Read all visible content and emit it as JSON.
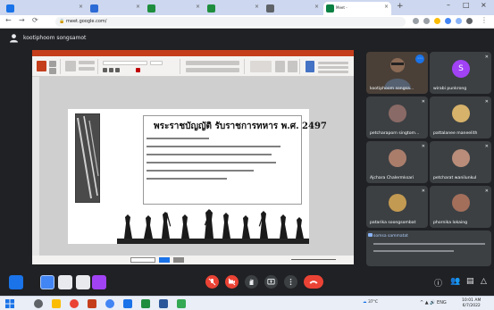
{
  "browser": {
    "tabs": [
      {
        "label": "",
        "color": "#1a73e8"
      },
      {
        "label": "",
        "color": "#2c6ad6"
      },
      {
        "label": "",
        "color": "#1e8e3e"
      },
      {
        "label": "",
        "color": "#1e8e3e"
      },
      {
        "label": "",
        "color": "#5f6368"
      },
      {
        "label": "Meet - ",
        "color": "#0b8043"
      }
    ],
    "url": "meet.google.com/"
  },
  "meet": {
    "presenter": "kootiphoom songsamot",
    "accent": "#1a73e8",
    "end_call_color": "#ea4335"
  },
  "slide": {
    "title": "พระราชบัญญัติ รับราชการทหาร พ.ศ. 2497",
    "ribbon_title": ""
  },
  "participants": [
    {
      "name": "kootiphoom songsa...",
      "avatar": "photo",
      "color": "#6d5a4a"
    },
    {
      "name": "wirabi punkrong",
      "avatar": "S",
      "color": "#a142f4"
    },
    {
      "name": "petcharaporn singtom...",
      "avatar": "photo",
      "color": "#8a6a66"
    },
    {
      "name": "pattalanee maneelith",
      "avatar": "photo",
      "color": "#d7b26a"
    },
    {
      "name": "Ajchara Chalermksari",
      "avatar": "photo",
      "color": "#aa7d6b"
    },
    {
      "name": "petcharat wanilunkul",
      "avatar": "photo",
      "color": "#b98d7a"
    },
    {
      "name": "patarika soongsombat",
      "avatar": "photo",
      "color": "#c39a52"
    },
    {
      "name": "phornika lokaing",
      "avatar": "photo",
      "color": "#a36f5b"
    }
  ],
  "chat": {
    "name": "somsa sammatat",
    "message": ""
  },
  "taskbar": {
    "weather": "37°C",
    "time": "10:01 AM",
    "date": "6/7/2022"
  }
}
